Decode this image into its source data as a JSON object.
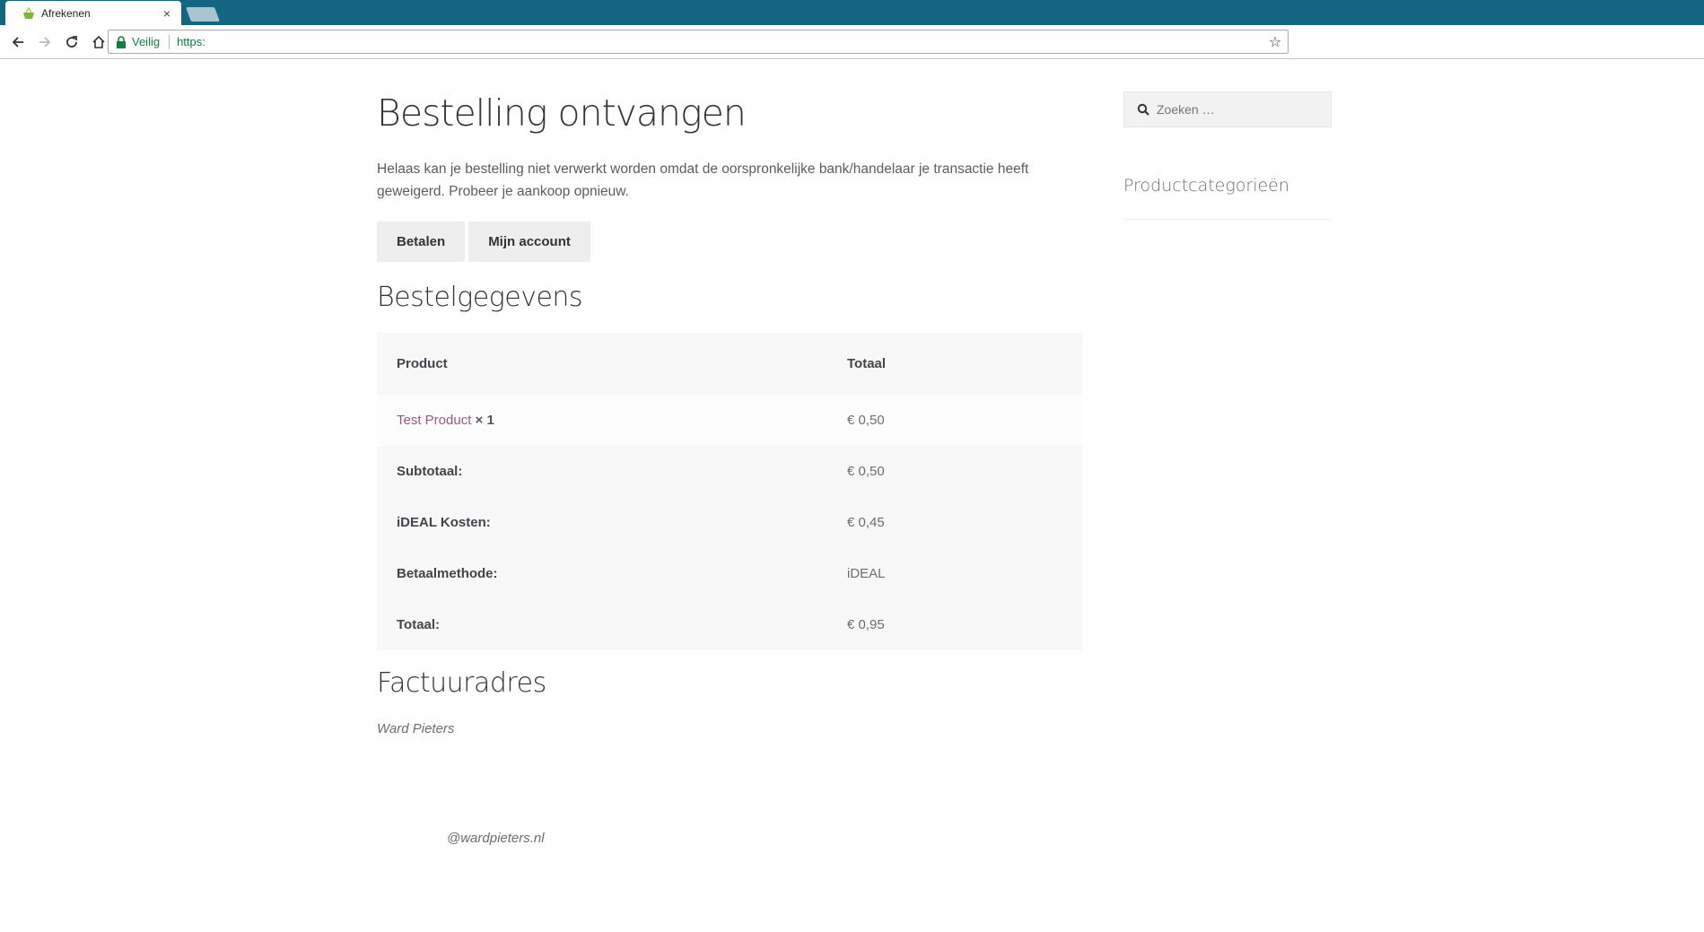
{
  "browser": {
    "tab_title": "Afrekenen",
    "tab_close": "×",
    "secure_label": "Veilig",
    "url": "https:"
  },
  "page": {
    "title": "Bestelling ontvangen",
    "notice": "Helaas kan je bestelling niet verwerkt worden omdat de oorspronkelijke bank/handelaar je transactie heeft geweigerd. Probeer je aankoop opnieuw.",
    "buttons": {
      "pay": "Betalen",
      "account": "Mijn account"
    },
    "order_details_title": "Bestelgegevens",
    "table": {
      "head_product": "Product",
      "head_total": "Totaal",
      "items": [
        {
          "name": "Test Product",
          "qty": "× 1",
          "total": "€ 0,50"
        }
      ],
      "summary": [
        {
          "label": "Subtotaal:",
          "value": "€ 0,50"
        },
        {
          "label": "iDEAL Kosten:",
          "value": "€ 0,45"
        },
        {
          "label": "Betaalmethode:",
          "value": "iDEAL"
        },
        {
          "label": "Totaal:",
          "value": "€ 0,95"
        }
      ]
    },
    "billing_title": "Factuuradres",
    "billing_name": "Ward Pieters",
    "footer_credit": "@wardpieters.nl"
  },
  "sidebar": {
    "search_placeholder": "Zoeken …",
    "widget_title": "Productcategorieën"
  },
  "colors": {
    "tabbar": "#136581",
    "link": "#96588a",
    "secure": "#0b8043"
  }
}
